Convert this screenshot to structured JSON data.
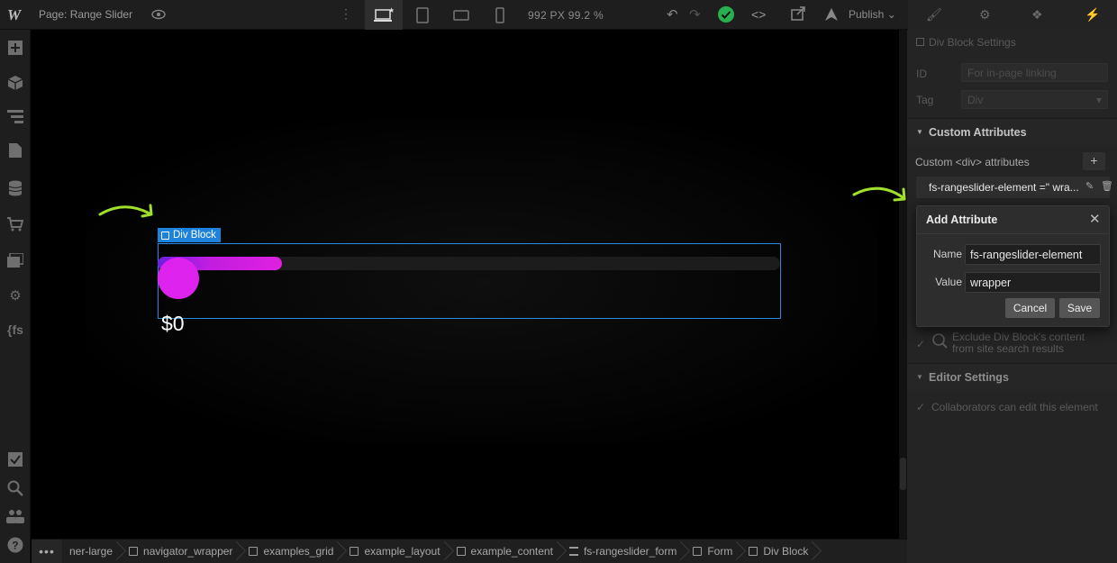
{
  "topbar": {
    "page_label": "Page: Range Slider",
    "dimensions": "992 PX  99.2 %",
    "publish_label": "Publish"
  },
  "canvas": {
    "selection_tag": "Div Block",
    "slider": {
      "value_text": "$0",
      "fill_fraction": 0.2
    }
  },
  "right_panel": {
    "settings_title": "Div Block Settings",
    "id_label": "ID",
    "id_placeholder": "For in-page linking",
    "tag_label": "Tag",
    "tag_value": "Div",
    "custom_attributes_header": "Custom Attributes",
    "custom_attributes_label": "Custom <div> attributes",
    "attribute_row": "fs-rangeslider-element =\" wra...",
    "search_exclude": "Exclude Div Block's content from site search results",
    "editor_settings_header": "Editor Settings",
    "collaborators_text": "Collaborators can edit this element"
  },
  "modal": {
    "title": "Add Attribute",
    "name_label": "Name",
    "name_value": "fs-rangeslider-element",
    "value_label": "Value",
    "value_value": "wrapper",
    "cancel_label": "Cancel",
    "save_label": "Save"
  },
  "breadcrumbs": {
    "items": [
      "ner-large",
      "navigator_wrapper",
      "examples_grid",
      "example_layout",
      "example_content",
      "fs-rangeslider_form",
      "Form",
      "Div Block"
    ]
  },
  "colors": {
    "accent_blue": "#1d82dc",
    "slider_pink": "#df23ee",
    "arrow_green": "#9fe02a"
  }
}
